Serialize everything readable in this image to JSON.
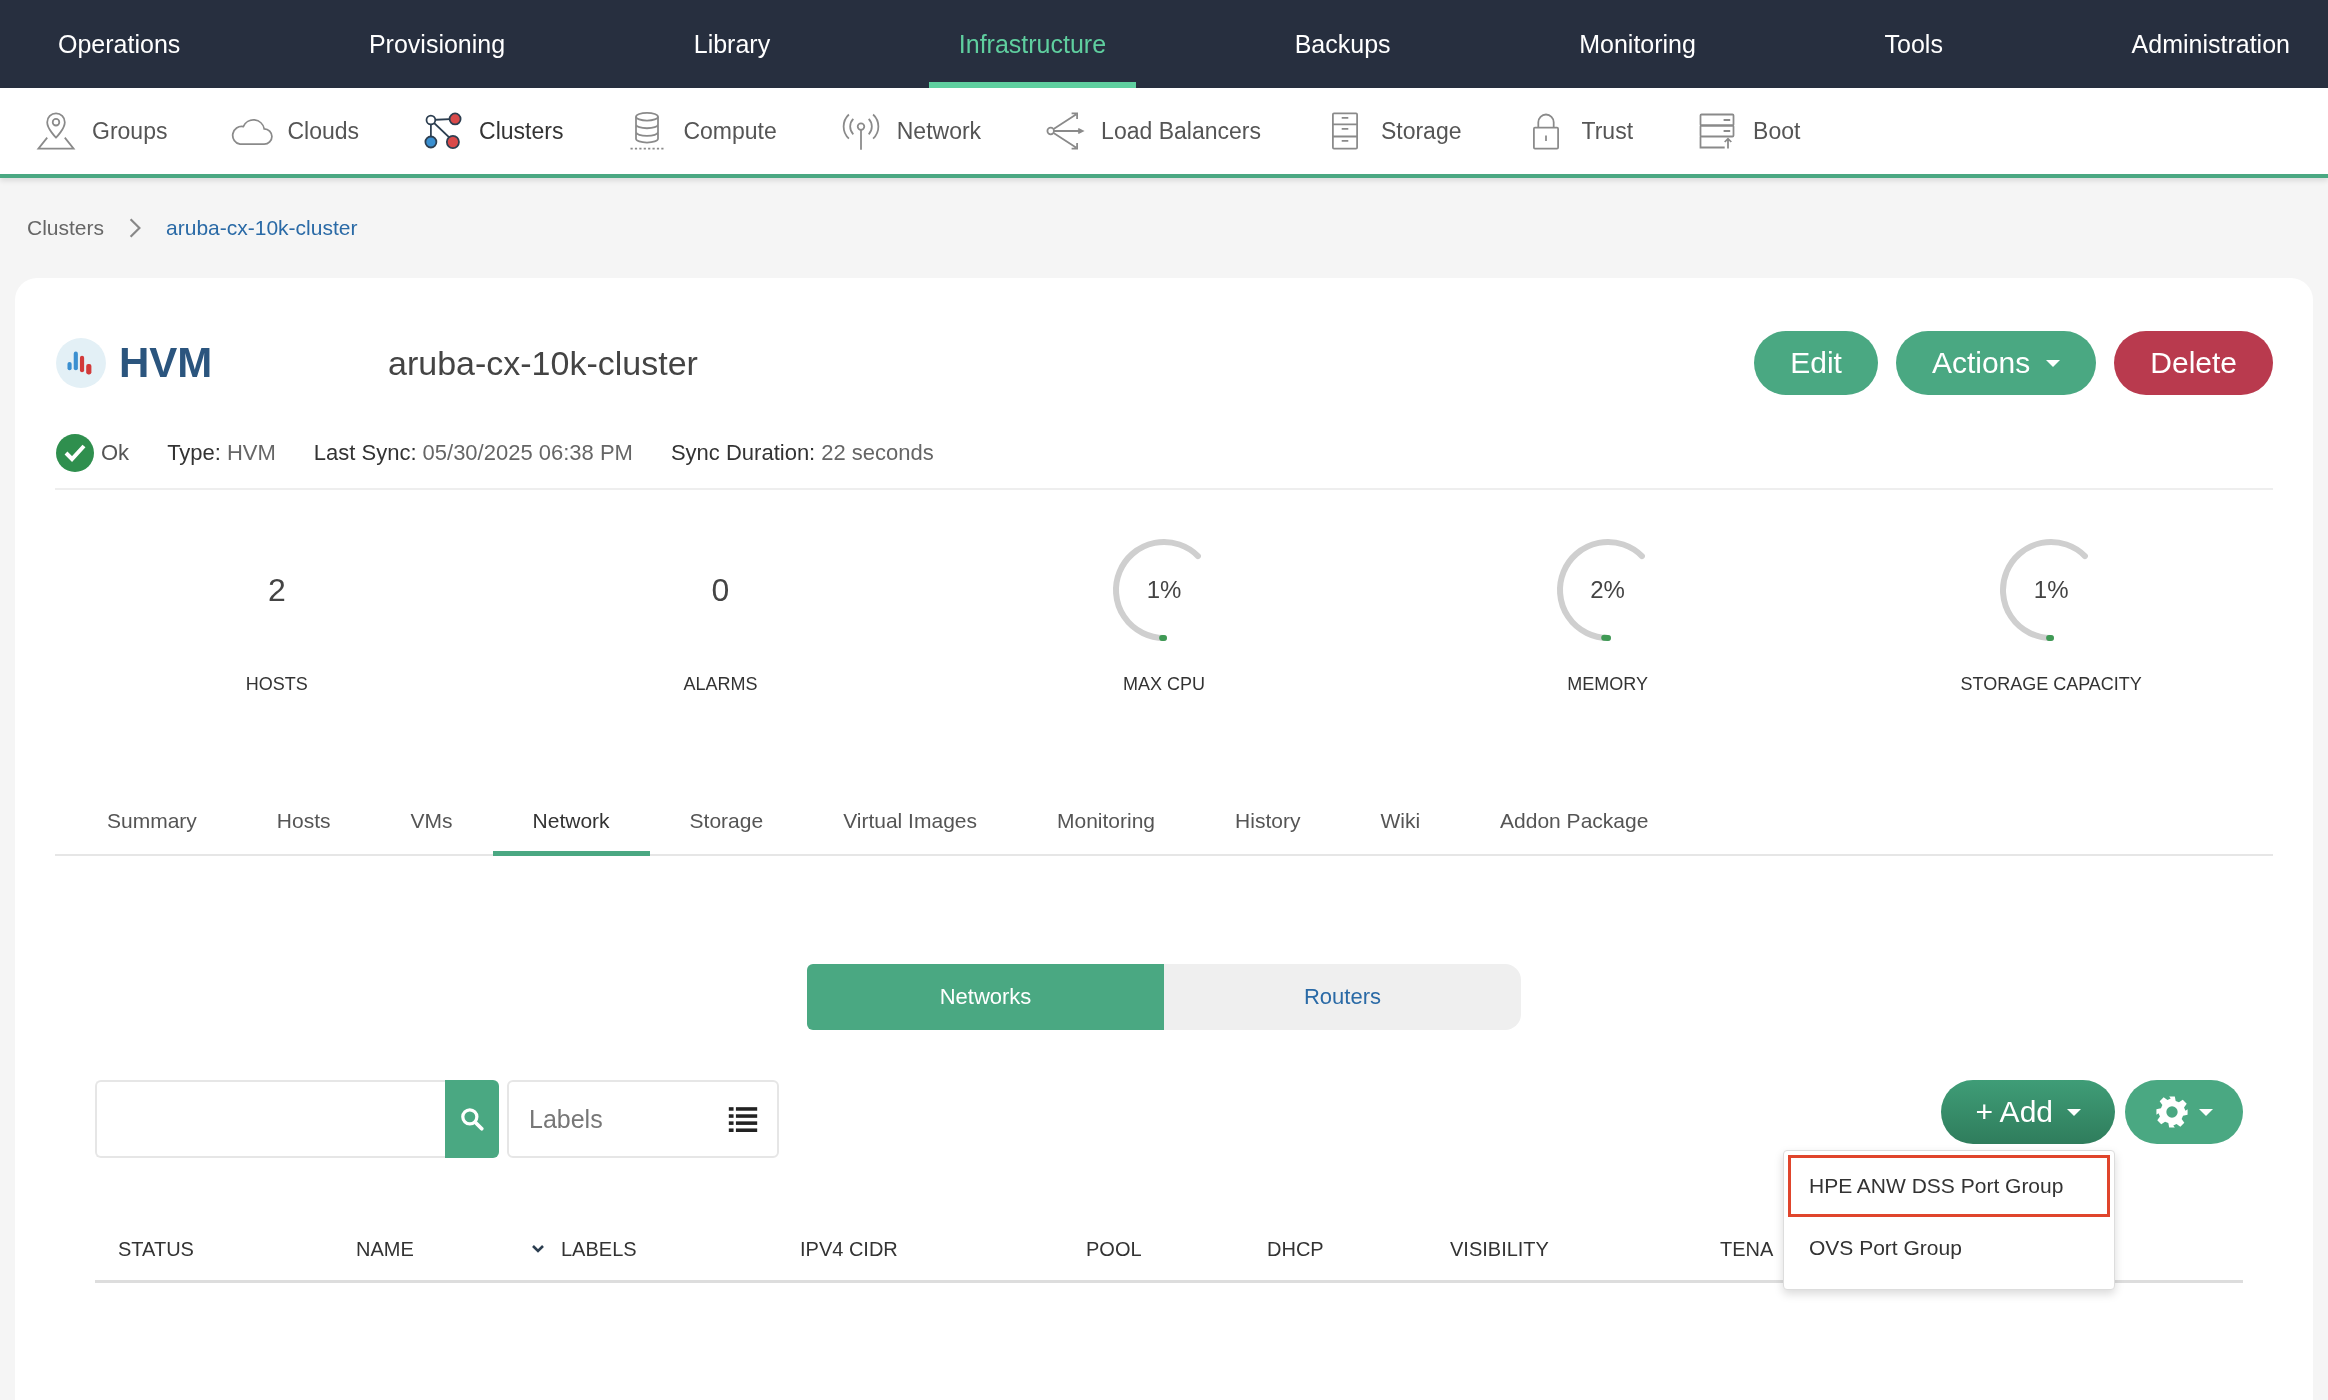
{
  "top_nav": [
    {
      "label": "Operations",
      "selected": false
    },
    {
      "label": "Provisioning",
      "selected": false
    },
    {
      "label": "Library",
      "selected": false
    },
    {
      "label": "Infrastructure",
      "selected": true
    },
    {
      "label": "Backups",
      "selected": false
    },
    {
      "label": "Monitoring",
      "selected": false
    },
    {
      "label": "Tools",
      "selected": false
    },
    {
      "label": "Administration",
      "selected": false
    }
  ],
  "sub_nav": [
    {
      "label": "Groups",
      "selected": false
    },
    {
      "label": "Clouds",
      "selected": false
    },
    {
      "label": "Clusters",
      "selected": true
    },
    {
      "label": "Compute",
      "selected": false
    },
    {
      "label": "Network",
      "selected": false
    },
    {
      "label": "Load Balancers",
      "selected": false
    },
    {
      "label": "Storage",
      "selected": false
    },
    {
      "label": "Trust",
      "selected": false
    },
    {
      "label": "Boot",
      "selected": false
    }
  ],
  "breadcrumb": {
    "parent": "Clusters",
    "current": "aruba-cx-10k-cluster"
  },
  "cluster": {
    "logo_text": "HVM",
    "name": "aruba-cx-10k-cluster"
  },
  "actions": [
    {
      "label": "Edit",
      "kind": "primary"
    },
    {
      "label": "Actions",
      "kind": "dropdown"
    },
    {
      "label": "Delete",
      "kind": "danger"
    }
  ],
  "status": {
    "label": "Ok",
    "ok": true
  },
  "details": [
    {
      "label": "Type:",
      "value": "HVM"
    },
    {
      "label": "Last Sync:",
      "value": "05/30/2025 06:38 PM"
    },
    {
      "label": "Sync Duration:",
      "value": "22 seconds"
    }
  ],
  "stats": [
    {
      "kind": "count",
      "value": "2",
      "label": "HOSTS"
    },
    {
      "kind": "count",
      "value": "0",
      "label": "ALARMS"
    },
    {
      "kind": "gauge",
      "reading": "1%",
      "level": 0.01,
      "label": "MAX CPU"
    },
    {
      "kind": "gauge",
      "reading": "2%",
      "level": 0.02,
      "label": "MEMORY"
    },
    {
      "kind": "gauge",
      "reading": "1%",
      "level": 0.01,
      "label": "STORAGE CAPACITY"
    }
  ],
  "tabs": [
    {
      "label": "Summary",
      "selected": false
    },
    {
      "label": "Hosts",
      "selected": false
    },
    {
      "label": "VMs",
      "selected": false
    },
    {
      "label": "Network",
      "selected": true
    },
    {
      "label": "Storage",
      "selected": false
    },
    {
      "label": "Virtual Images",
      "selected": false
    },
    {
      "label": "Monitoring",
      "selected": false
    },
    {
      "label": "History",
      "selected": false
    },
    {
      "label": "Wiki",
      "selected": false
    },
    {
      "label": "Addon Package",
      "selected": false
    }
  ],
  "view_toggle": [
    {
      "label": "Networks",
      "selected": true
    },
    {
      "label": "Routers",
      "selected": false
    }
  ],
  "labels_filter": {
    "placeholder": "Labels"
  },
  "add_button": {
    "label": "+ Add"
  },
  "add_menu": [
    {
      "label": "HPE ANW DSS Port Group",
      "highlighted": true
    },
    {
      "label": "OVS Port Group",
      "highlighted": false
    }
  ],
  "table": {
    "columns": [
      {
        "label": "STATUS",
        "sorted": false
      },
      {
        "label": "NAME",
        "sorted": true
      },
      {
        "label": "LABELS",
        "sorted": false
      },
      {
        "label": "IPV4 CIDR",
        "sorted": false
      },
      {
        "label": "POOL",
        "sorted": false
      },
      {
        "label": "DHCP",
        "sorted": false
      },
      {
        "label": "VISIBILITY",
        "sorted": false
      },
      {
        "label": "TENA",
        "sorted": false
      }
    ]
  }
}
